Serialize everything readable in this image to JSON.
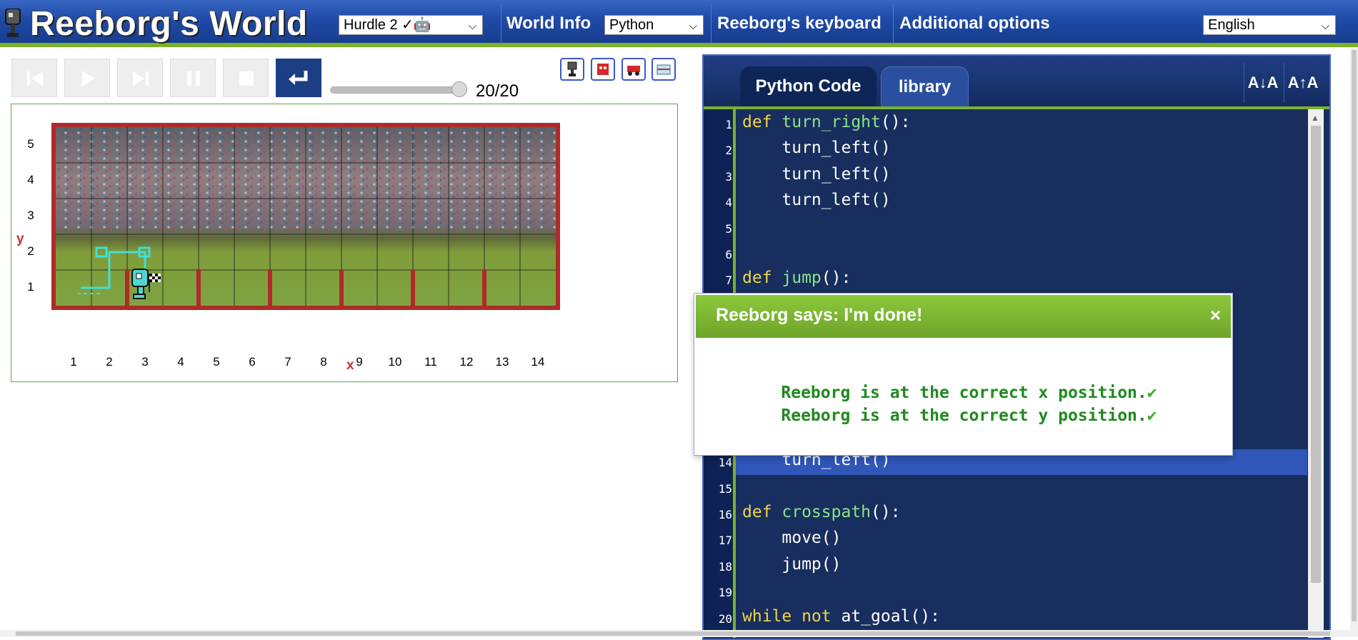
{
  "header": {
    "title": "Reeborg's World",
    "world_select": "Hurdle 2 ✓🤖",
    "world_info": "World Info",
    "language_select": "Python",
    "keyboard": "Reeborg's keyboard",
    "additional": "Additional options",
    "ui_language": "English"
  },
  "controls": {
    "step_counter": "20/20",
    "speed_fraction": 1.0
  },
  "world": {
    "x_label": "x",
    "y_label": "y",
    "x_ticks": [
      "1",
      "2",
      "3",
      "4",
      "5",
      "6",
      "7",
      "8",
      "9",
      "10",
      "11",
      "12",
      "13",
      "14"
    ],
    "y_ticks": [
      "5",
      "4",
      "3",
      "2",
      "1"
    ],
    "walls_east_of_x": [
      2,
      4,
      6,
      8,
      10,
      12
    ],
    "robot_x": 3,
    "robot_y": 1,
    "goal_x": 3,
    "goal_y": 1,
    "trace_color": "#3fe0d8",
    "wall_color": "#b02a2a"
  },
  "editor": {
    "tab_code": "Python Code",
    "tab_library": "library",
    "font_down": "A↓A",
    "font_up": "A↑A",
    "highlight_line": 14,
    "lines": [
      {
        "n": "1",
        "t": [
          [
            "kw",
            "def "
          ],
          [
            "fn",
            "turn_right"
          ],
          [
            "p",
            "():"
          ]
        ]
      },
      {
        "n": "2",
        "t": [
          [
            "p",
            "    turn_left()"
          ]
        ]
      },
      {
        "n": "3",
        "t": [
          [
            "p",
            "    turn_left()"
          ]
        ]
      },
      {
        "n": "4",
        "t": [
          [
            "p",
            "    turn_left()"
          ]
        ]
      },
      {
        "n": "5",
        "t": []
      },
      {
        "n": "6",
        "t": []
      },
      {
        "n": "7",
        "t": [
          [
            "kw",
            "def "
          ],
          [
            "fn",
            "jump"
          ],
          [
            "p",
            "():"
          ]
        ]
      },
      {
        "n": "14",
        "t": [
          [
            "p",
            "    turn_left()"
          ]
        ]
      },
      {
        "n": "15",
        "t": []
      },
      {
        "n": "16",
        "t": [
          [
            "kw",
            "def "
          ],
          [
            "fn",
            "crosspath"
          ],
          [
            "p",
            "():"
          ]
        ]
      },
      {
        "n": "17",
        "t": [
          [
            "p",
            "    move()"
          ]
        ]
      },
      {
        "n": "18",
        "t": [
          [
            "p",
            "    jump()"
          ]
        ]
      },
      {
        "n": "19",
        "t": []
      },
      {
        "n": "20",
        "t": [
          [
            "kw",
            "while not "
          ],
          [
            "p",
            "at_goal():"
          ]
        ]
      }
    ]
  },
  "dialog": {
    "title": "Reeborg says: I'm done!",
    "close": "×",
    "messages": [
      "Reeborg is at the correct x position.",
      "Reeborg is at the correct y position."
    ],
    "check": "✔"
  }
}
